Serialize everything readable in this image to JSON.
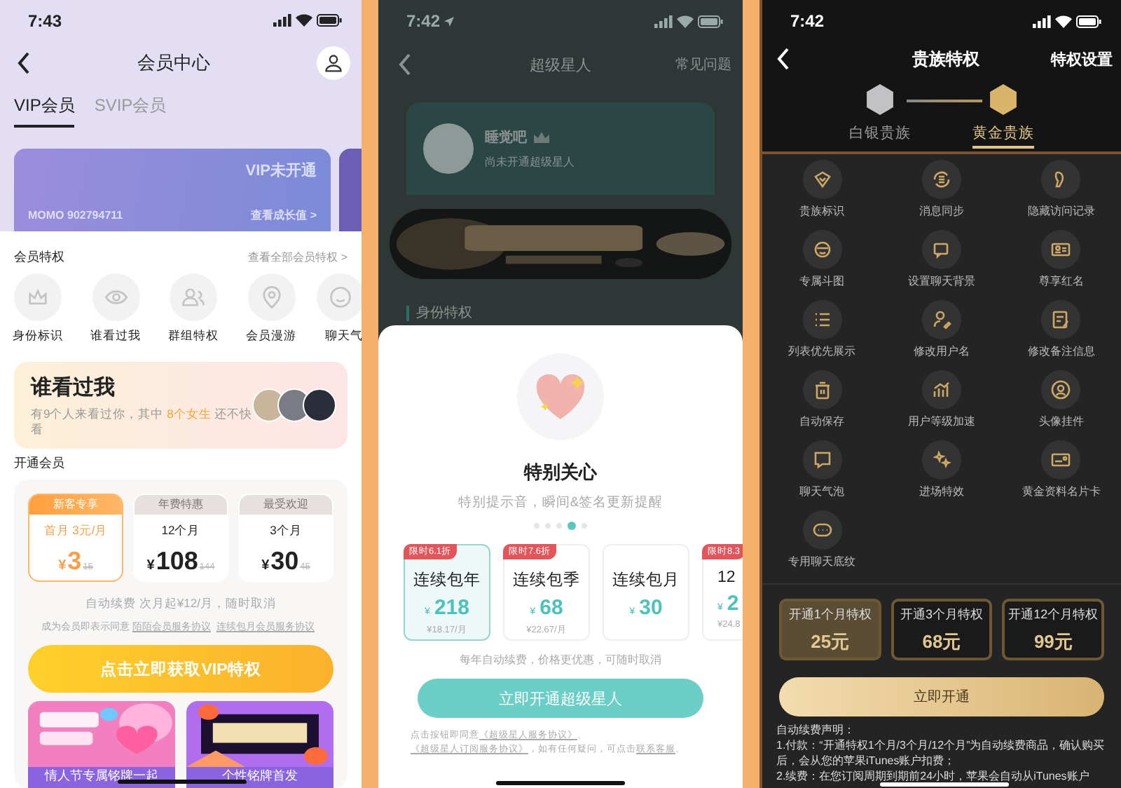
{
  "vip_center": {
    "status_time": "7:43",
    "title": "会员中心",
    "tabs": [
      {
        "label": "VIP会员",
        "selected": true
      },
      {
        "label": "SVIP会员",
        "selected": false
      }
    ],
    "card": {
      "status": "VIP未开通",
      "account": "MOMO 902794711",
      "growth_link": "查看成长值 >"
    },
    "privileges": {
      "title": "会员特权",
      "more": "查看全部会员特权 >",
      "items": [
        {
          "label": "身份标识"
        },
        {
          "label": "谁看过我"
        },
        {
          "label": "群组特权"
        },
        {
          "label": "会员漫游"
        },
        {
          "label": "聊天气"
        }
      ]
    },
    "visitors": {
      "title": "谁看过我",
      "text": "有9个人来看过你，其中 **8个女生** 还不快看"
    },
    "plans_title": "开通会员",
    "plans": [
      {
        "tag": "新客专享",
        "term": "首月 3元/月",
        "currency": "¥",
        "price": "3",
        "original": "15",
        "selected": true
      },
      {
        "tag": "年费特惠",
        "term": "12个月",
        "currency": "¥",
        "price": "108",
        "original": "144",
        "selected": false
      },
      {
        "tag": "最受欢迎",
        "term": "3个月",
        "currency": "¥",
        "price": "30",
        "original": "45",
        "selected": false
      }
    ],
    "renew_note": "自动续费 次月起¥12/月，随时取消",
    "agreement": [
      {
        "kind": "text",
        "text": "成为会员即表示同意 "
      },
      {
        "kind": "link",
        "text": "陌陌会员服务协议"
      },
      {
        "kind": "link",
        "text": "连续包月会员服务协议"
      }
    ],
    "cta": "点击立即获取VIP特权",
    "banners": [
      {
        "caption": "情人节专属铭牌一起"
      },
      {
        "caption": "个性铭牌首发"
      }
    ]
  },
  "super_star": {
    "status_time": "7:42",
    "title": "超级星人",
    "faq": "常见问题",
    "profile": {
      "name": "睡觉吧",
      "status": "尚未开通超级星人"
    },
    "section": "身份特权",
    "sheet": {
      "title": "特别关心",
      "subtitle": "特别提示音，瞬间&签名更新提醒",
      "pages": [
        {
          "selected": false
        },
        {
          "selected": false
        },
        {
          "selected": false
        },
        {
          "selected": true
        },
        {
          "selected": false
        }
      ],
      "plans": [
        {
          "badge": "限时6.1折",
          "name": "连续包年",
          "currency": "¥",
          "price": "218",
          "per_month": "¥18.17/月",
          "selected": true
        },
        {
          "badge": "限时7.6折",
          "name": "连续包季",
          "currency": "¥",
          "price": "68",
          "per_month": "¥22.67/月",
          "selected": false
        },
        {
          "name": "连续包月",
          "currency": "¥",
          "price": "30",
          "selected": false
        },
        {
          "badge": "限时8.3",
          "name": "12",
          "currency": "¥",
          "price": "2",
          "per_month": "¥24.8",
          "selected": false
        }
      ],
      "note": "每年自动续费，价格更优惠，可随时取消",
      "cta": "立即开通超级星人",
      "legal": [
        {
          "kind": "text",
          "text": "点击按钮即同意"
        },
        {
          "kind": "link",
          "text": "《超级星人服务协议》"
        },
        {
          "kind": "text",
          "text": "、"
        },
        {
          "kind": "link",
          "text": "《超级星人订阅服务协议》"
        },
        {
          "kind": "text",
          "text": "，如有任何疑问，可点击"
        },
        {
          "kind": "link",
          "text": "联系客服"
        },
        {
          "kind": "text",
          "text": "。"
        }
      ]
    }
  },
  "noble": {
    "status_time": "7:42",
    "title": "贵族特权",
    "settings": "特权设置",
    "levels": [
      {
        "label": "白银贵族",
        "color": "#c2c2c4",
        "selected": false
      },
      {
        "label": "黄金贵族",
        "color": "#d9b46a",
        "selected": true
      }
    ],
    "privileges": [
      {
        "label": "贵族标识"
      },
      {
        "label": "消息同步"
      },
      {
        "label": "隐藏访问记录"
      },
      {
        "label": "专属斗图"
      },
      {
        "label": "设置聊天背景"
      },
      {
        "label": "尊享红名"
      },
      {
        "label": "列表优先展示"
      },
      {
        "label": "修改用户名"
      },
      {
        "label": "修改备注信息"
      },
      {
        "label": "自动保存"
      },
      {
        "label": "用户等级加速"
      },
      {
        "label": "头像挂件"
      },
      {
        "label": "聊天气泡"
      },
      {
        "label": "进场特效"
      },
      {
        "label": "黄金资料名片卡"
      },
      {
        "label": "专用聊天底纹"
      }
    ],
    "options": [
      {
        "term": "开通1个月特权",
        "price": "25元",
        "selected": true
      },
      {
        "term": "开通3个月特权",
        "price": "68元",
        "selected": false
      },
      {
        "term": "开通12个月特权",
        "price": "99元",
        "selected": false
      }
    ],
    "cta": "立即开通",
    "notice": [
      "自动续费声明：",
      "1.付款：“开通特权1个月/3个月/12个月”为自动续费商品，确认购买后，会从您的苹果iTunes账户扣费；",
      "2.续费：在您订阅周期到期前24小时，苹果会自动从iTunes账户"
    ]
  }
}
